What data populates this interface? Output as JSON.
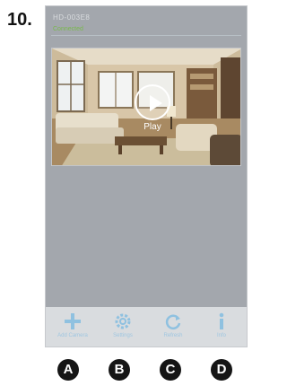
{
  "step_number": "10.",
  "camera": {
    "id": "HD-003E8",
    "status": "Connected"
  },
  "feed": {
    "play_label": "Play"
  },
  "toolbar": {
    "items": [
      {
        "label": "Add Camera",
        "icon": "plus-icon"
      },
      {
        "label": "Settings",
        "icon": "gear-icon"
      },
      {
        "label": "Refresh",
        "icon": "refresh-icon"
      },
      {
        "label": "Info",
        "icon": "info-icon"
      }
    ]
  },
  "callouts": [
    "A",
    "B",
    "C",
    "D"
  ],
  "colors": {
    "screen_bg": "#a3a7ad",
    "toolbar_bg": "#d9dcdf",
    "toolbar_icon": "#8fc1e0",
    "status_green": "#79b84c",
    "callout_bg": "#151515"
  }
}
